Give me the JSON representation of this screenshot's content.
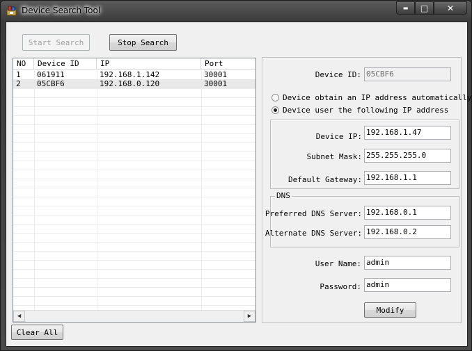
{
  "window": {
    "title": "Device Search Tool",
    "min_glyph": "▬",
    "max_glyph": "□",
    "close_glyph": "✕",
    "icon": "app-icon"
  },
  "toolbar": {
    "start_search": "Start Search",
    "stop_search": "Stop Search"
  },
  "device_list": {
    "columns": [
      "NO",
      "Device ID",
      "IP",
      "Port"
    ],
    "rows": [
      {
        "no": "1",
        "device_id": "061911",
        "ip": "192.168.1.142",
        "port": "30001"
      },
      {
        "no": "2",
        "device_id": "05CBF6",
        "ip": "192.168.0.120",
        "port": "30001"
      }
    ],
    "scroll_left": "◀",
    "scroll_right": "▶"
  },
  "clear_all": "Clear All",
  "settings": {
    "device_id_label": "Device ID:",
    "device_id_value": "05CBF6",
    "radio_auto": "Device obtain an IP address automatically",
    "radio_manual": "Device user the following IP address",
    "selected_mode": "manual",
    "device_ip_label": "Device IP:",
    "device_ip_value": "192.168.1.47",
    "subnet_label": "Subnet Mask:",
    "subnet_value": "255.255.255.0",
    "gateway_label": "Default Gateway:",
    "gateway_value": "192.168.1.1",
    "dns_group_title": "DNS",
    "pref_dns_label": "Preferred DNS Server:",
    "pref_dns_value": "192.168.0.1",
    "alt_dns_label": "Alternate DNS Server:",
    "alt_dns_value": "192.168.0.2",
    "username_label": "User Name:",
    "username_value": "admin",
    "password_label": "Password:",
    "password_value": "admin",
    "modify_label": "Modify"
  },
  "colors": {
    "frame": "#3c3c3c",
    "client_bg": "#f0f0f0",
    "row_alt": "#e8e8e8"
  }
}
